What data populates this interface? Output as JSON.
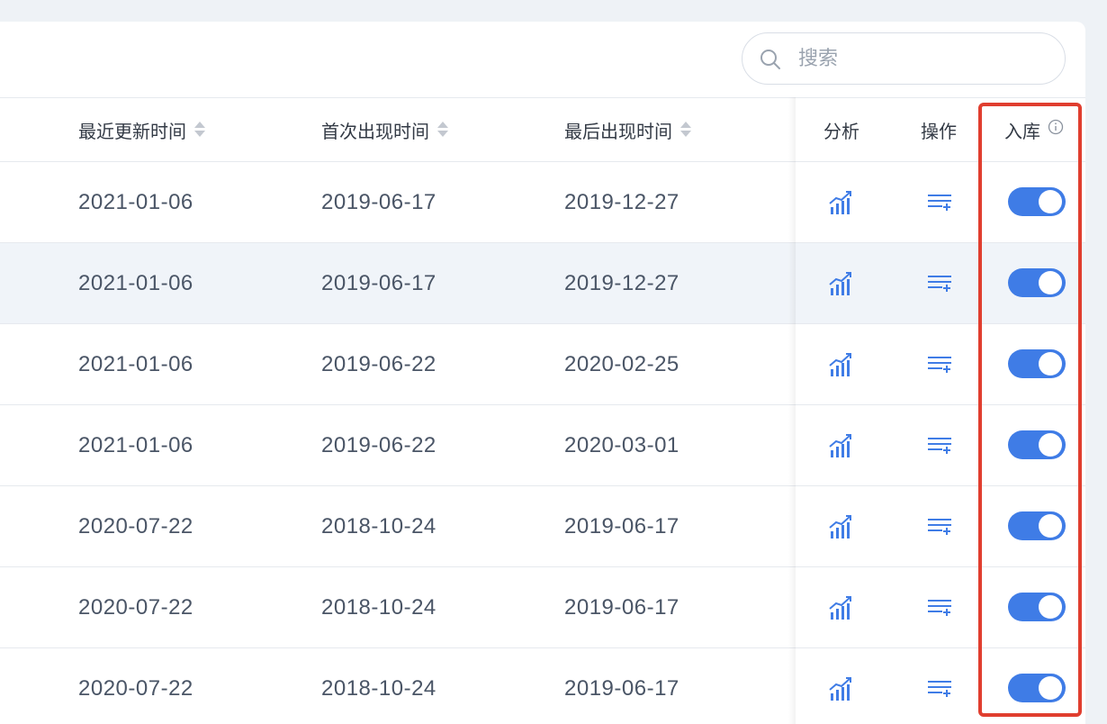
{
  "search": {
    "placeholder": "搜索"
  },
  "columns": {
    "updated": "最近更新时间",
    "first_seen": "首次出现时间",
    "last_seen": "最后出现时间",
    "analysis": "分析",
    "actions": "操作",
    "storage": "入库"
  },
  "rows": [
    {
      "updated": "2021-01-06",
      "first_seen": "2019-06-17",
      "last_seen": "2019-12-27",
      "stored": true
    },
    {
      "updated": "2021-01-06",
      "first_seen": "2019-06-17",
      "last_seen": "2019-12-27",
      "stored": true
    },
    {
      "updated": "2021-01-06",
      "first_seen": "2019-06-22",
      "last_seen": "2020-02-25",
      "stored": true
    },
    {
      "updated": "2021-01-06",
      "first_seen": "2019-06-22",
      "last_seen": "2020-03-01",
      "stored": true
    },
    {
      "updated": "2020-07-22",
      "first_seen": "2018-10-24",
      "last_seen": "2019-06-17",
      "stored": true
    },
    {
      "updated": "2020-07-22",
      "first_seen": "2018-10-24",
      "last_seen": "2019-06-17",
      "stored": true
    },
    {
      "updated": "2020-07-22",
      "first_seen": "2018-10-24",
      "last_seen": "2019-06-17",
      "stored": true
    }
  ],
  "icons": {
    "search": "search-icon",
    "analysis": "analysis-chart-icon",
    "action": "list-add-icon",
    "info": "info-icon"
  },
  "colors": {
    "accent": "#3f7ce6",
    "highlight_border": "#e03e2f",
    "row_hover": "#f0f4f9"
  }
}
